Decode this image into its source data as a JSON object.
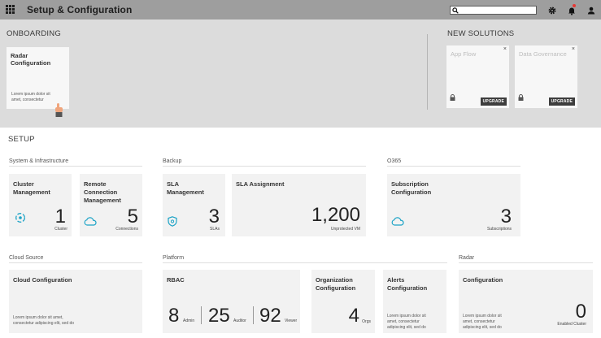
{
  "app": {
    "title": "Setup & Configuration"
  },
  "topbar": {
    "search_value": "",
    "icons": [
      "apps-grid-icon",
      "search-icon",
      "gear-icon",
      "bell-icon",
      "user-icon"
    ],
    "notification_color": "#e53935"
  },
  "onboarding": {
    "heading": "ONBOARDING",
    "card": {
      "title_line1": "Radar",
      "title_line2": "Configuration",
      "desc_line1": "Lorem ipsum dolor sit",
      "desc_line2": "amet, consectetur"
    }
  },
  "new_solutions": {
    "heading": "NEW SOLUTIONS",
    "cards": [
      {
        "title": "App Flow",
        "close": "×",
        "button": "UPGRADE"
      },
      {
        "title": "Data Governance",
        "close": "×",
        "button": "UPGRADE"
      }
    ]
  },
  "setup": {
    "heading": "SETUP",
    "groups": {
      "system": "System & Infrastructure",
      "backup": "Backup",
      "o365": "O365",
      "cloud": "Cloud Source",
      "platform": "Platform",
      "radar": "Radar"
    },
    "cards": {
      "cluster": {
        "title_line1": "Cluster",
        "title_line2": "Management",
        "value": "1",
        "unit": "Cluster"
      },
      "remote": {
        "title_line1": "Remote",
        "title_line2": "Connection",
        "title_line3": "Management",
        "value": "5",
        "unit": "Connections"
      },
      "sla_mgmt": {
        "title_line1": "SLA",
        "title_line2": "Management",
        "value": "3",
        "unit": "SLAs"
      },
      "sla_assign": {
        "title": "SLA Assignment",
        "value": "1,200",
        "unit": "Unprotected VM"
      },
      "subscription": {
        "title_line1": "Subscription",
        "title_line2": "Configuration",
        "value": "3",
        "unit": "Subscriptions"
      },
      "cloud_config": {
        "title": "Cloud Configuration",
        "desc_line1": "Lorem ipsum dolor sit amet,",
        "desc_line2": "consectetur adipiscing elit, sed do"
      },
      "rbac": {
        "title": "RBAC",
        "admin_value": "8",
        "admin_unit": "Admin",
        "auditor_value": "25",
        "auditor_unit": "Auditor",
        "viewer_value": "92",
        "viewer_unit": "Viewer"
      },
      "org": {
        "title_line1": "Organization",
        "title_line2": "Configuration",
        "value": "4",
        "unit": "Orgs"
      },
      "alerts": {
        "title_line1": "Alerts",
        "title_line2": "Configuration",
        "desc_line1": "Lorem ipsum dolor sit",
        "desc_line2": "amet, consectetur",
        "desc_line3": "adipiscing elit, sed do"
      },
      "radar_config": {
        "title": "Configuration",
        "value": "0",
        "unit": "Enabled Cluster",
        "desc_line1": "Lorem ipsum dolor sit",
        "desc_line2": "amet, consectetur",
        "desc_line3": "adipiscing elit, sed do"
      }
    }
  },
  "colors": {
    "accent": "#1ba3c6",
    "topbar": "#9e9e9e",
    "band": "#dcdcdc"
  }
}
